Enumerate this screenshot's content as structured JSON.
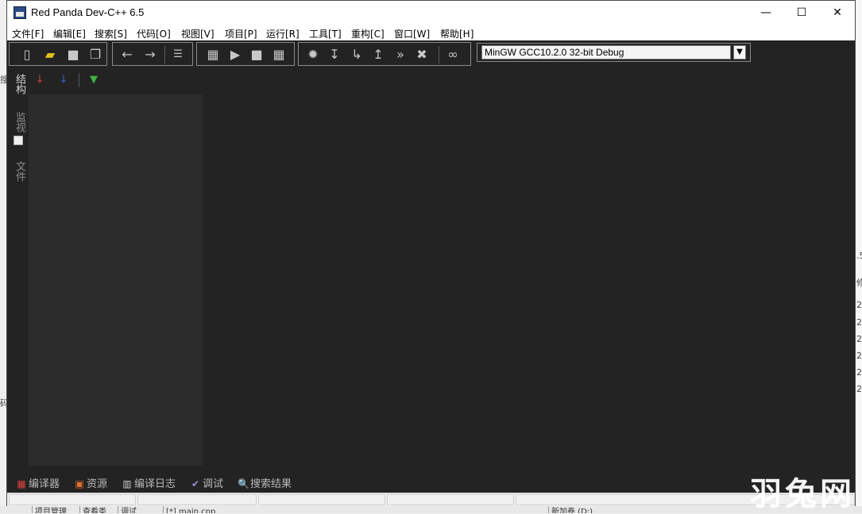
{
  "window": {
    "title": "Red Panda Dev-C++ 6.5",
    "controls": {
      "minimize": "—",
      "maximize": "☐",
      "close": "✕"
    }
  },
  "menu": [
    "文件[F]",
    "编辑[E]",
    "搜索[S]",
    "代码[O]",
    "视图[V]",
    "项目[P]",
    "运行[R]",
    "工具[T]",
    "重构[C]",
    "窗口[W]",
    "帮助[H]"
  ],
  "toolbar": {
    "compiler_selected": "MinGW GCC10.2.0 32-bit Debug"
  },
  "side_tabs": [
    "结构",
    "监视",
    "文件"
  ],
  "bottom_tabs": [
    "编译器",
    "资源",
    "编译日志",
    "调试",
    "搜索结果"
  ],
  "background_fragments": {
    "taskbar_tabs": [
      "项目管理",
      "查看类",
      "调试",
      "[*] main.cpp",
      "新加卷 (D:)"
    ],
    "right_edge_texts": [
      ".5",
      "修",
      "2",
      "2",
      "2",
      "2",
      "2",
      "2"
    ],
    "left_edge_texts": [
      "搜",
      "码"
    ]
  },
  "watermark": "羽兔网",
  "colors": {
    "editor_bg": "#232323",
    "panel_bg": "#2c2c2c",
    "menubar_bg": "#ffffff"
  }
}
